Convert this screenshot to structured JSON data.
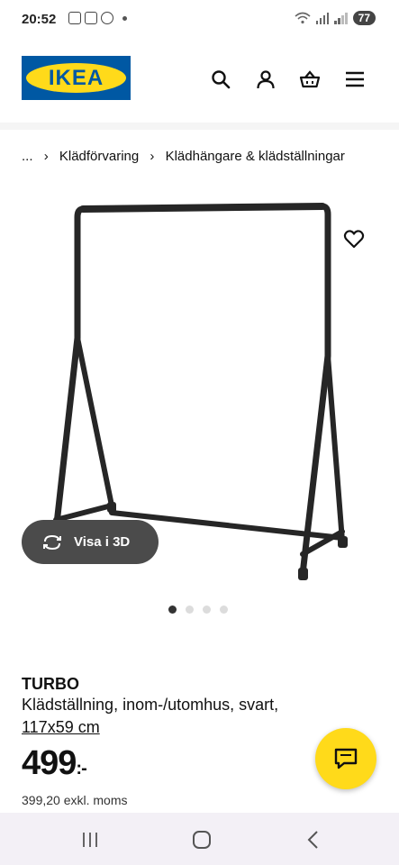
{
  "status": {
    "time": "20:52",
    "battery": "77"
  },
  "header": {
    "logo": "IKEA",
    "icons": [
      "search-icon",
      "account-icon",
      "basket-icon",
      "menu-icon"
    ]
  },
  "breadcrumb": {
    "ellipsis": "...",
    "items": [
      "Klädförvaring",
      "Klädhängare & klädställningar"
    ]
  },
  "product": {
    "name": "TURBO",
    "description": "Klädställning, inom-/utomhus, svart,",
    "size": "117x59 cm",
    "price": "499",
    "price_suffix": ":-",
    "price_ex_vat": "399,20 exkl. moms",
    "view3d_label": "Visa i 3D",
    "image_count": 4,
    "active_image": 1
  },
  "colors": {
    "ikea_blue": "#0058a3",
    "ikea_yellow": "#ffda1a",
    "pill_bg": "#4b4b4b"
  }
}
